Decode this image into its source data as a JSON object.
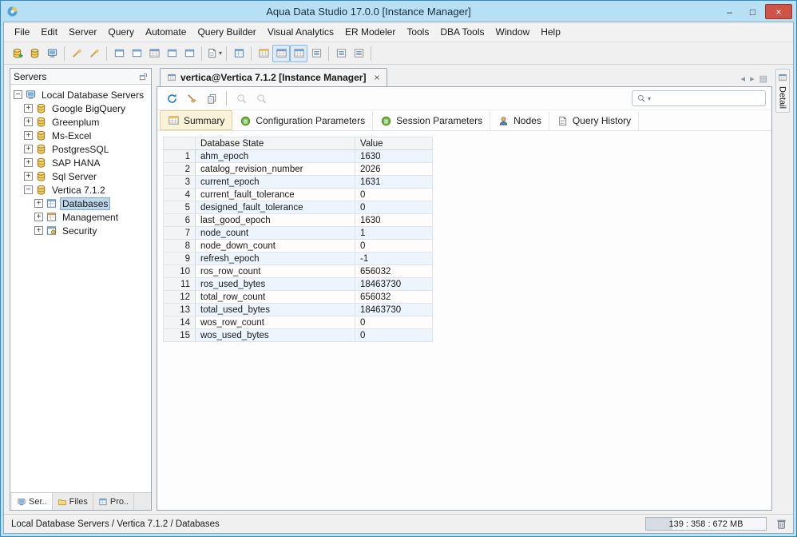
{
  "window": {
    "title": "Aqua Data Studio 17.0.0 [Instance Manager]",
    "controls": {
      "minimize": "–",
      "maximize": "□",
      "close": "×"
    }
  },
  "menu": {
    "items": [
      "File",
      "Edit",
      "Server",
      "Query",
      "Automate",
      "Query Builder",
      "Visual Analytics",
      "ER Modeler",
      "Tools",
      "DBA Tools",
      "Window",
      "Help"
    ]
  },
  "toolbar": {
    "icons": [
      {
        "name": "register-server",
        "sym": "dbplus"
      },
      {
        "name": "connect-server",
        "sym": "db"
      },
      {
        "name": "server-properties",
        "sym": "server"
      },
      {
        "sep": true
      },
      {
        "name": "schema-wizard",
        "sym": "wand"
      },
      {
        "name": "import-wizard",
        "sym": "wand"
      },
      {
        "sep": true
      },
      {
        "name": "window-query-analyzer",
        "sym": "win"
      },
      {
        "name": "window-admin",
        "sym": "win"
      },
      {
        "name": "window-instance-manager",
        "sym": "grid-b"
      },
      {
        "name": "window-storage",
        "sym": "win"
      },
      {
        "name": "window-security",
        "sym": "win"
      },
      {
        "sep": true
      },
      {
        "name": "new-document",
        "sym": "doc",
        "caret": true
      },
      {
        "sep": true
      },
      {
        "name": "server-browser",
        "sym": "objects"
      },
      {
        "sep": true
      },
      {
        "name": "view-summary",
        "sym": "grid-y"
      },
      {
        "name": "view-grid",
        "sym": "grid-b",
        "active": true
      },
      {
        "name": "view-pivot",
        "sym": "grid-b",
        "active": true
      },
      {
        "name": "view-form",
        "sym": "list"
      },
      {
        "sep": true
      },
      {
        "name": "view-text",
        "sym": "list"
      },
      {
        "name": "view-chart",
        "sym": "list"
      },
      {
        "sep": true
      }
    ]
  },
  "servers_panel": {
    "title": "Servers",
    "tree": [
      {
        "label": "Local Database Servers",
        "depth": 0,
        "expander": "-",
        "icon": "server"
      },
      {
        "label": "Google BigQuery",
        "depth": 1,
        "expander": "+",
        "icon": "db"
      },
      {
        "label": "Greenplum",
        "depth": 1,
        "expander": "+",
        "icon": "db"
      },
      {
        "label": "Ms-Excel",
        "depth": 1,
        "expander": "+",
        "icon": "db"
      },
      {
        "label": "PostgresSQL",
        "depth": 1,
        "expander": "+",
        "icon": "db"
      },
      {
        "label": "SAP HANA",
        "depth": 1,
        "expander": "+",
        "icon": "db"
      },
      {
        "label": "Sql Server",
        "depth": 1,
        "expander": "+",
        "icon": "db"
      },
      {
        "label": "Vertica 7.1.2",
        "depth": 1,
        "expander": "-",
        "icon": "db"
      },
      {
        "label": "Databases",
        "depth": 2,
        "expander": "+",
        "icon": "objects",
        "selected": true
      },
      {
        "label": "Management",
        "depth": 2,
        "expander": "+",
        "icon": "mgmt"
      },
      {
        "label": "Security",
        "depth": 2,
        "expander": "+",
        "icon": "security"
      }
    ],
    "bottom_tabs": [
      {
        "label": "Ser..",
        "icon": "server",
        "active": true
      },
      {
        "label": "Files",
        "icon": "folder"
      },
      {
        "label": "Pro..",
        "icon": "objects"
      }
    ]
  },
  "document": {
    "tab_label": "vertica@Vertica 7.1.2 [Instance Manager]",
    "close_glyph": "×",
    "toolbar_icons": [
      {
        "name": "refresh",
        "sym": "refresh"
      },
      {
        "name": "auto-format",
        "sym": "broom"
      },
      {
        "name": "copy",
        "sym": "copy"
      },
      {
        "sep": true
      },
      {
        "name": "zoom-out",
        "sym": "zoom",
        "disabled": true
      },
      {
        "name": "zoom-in",
        "sym": "zoom",
        "disabled": true
      }
    ]
  },
  "search": {
    "value": ""
  },
  "subtabs": [
    {
      "label": "Summary",
      "icon": "grid-y",
      "active": true
    },
    {
      "label": "Configuration Parameters",
      "icon": "param"
    },
    {
      "label": "Session Parameters",
      "icon": "param"
    },
    {
      "label": "Nodes",
      "icon": "node"
    },
    {
      "label": "Query History",
      "icon": "doc"
    }
  ],
  "grid": {
    "columns": [
      "Database State",
      "Value"
    ],
    "rows": [
      {
        "n": "1",
        "name": "ahm_epoch",
        "value": "1630"
      },
      {
        "n": "2",
        "name": "catalog_revision_number",
        "value": "2026"
      },
      {
        "n": "3",
        "name": "current_epoch",
        "value": "1631"
      },
      {
        "n": "4",
        "name": "current_fault_tolerance",
        "value": "0"
      },
      {
        "n": "5",
        "name": "designed_fault_tolerance",
        "value": "0"
      },
      {
        "n": "6",
        "name": "last_good_epoch",
        "value": "1630"
      },
      {
        "n": "7",
        "name": "node_count",
        "value": "1"
      },
      {
        "n": "8",
        "name": "node_down_count",
        "value": "0"
      },
      {
        "n": "9",
        "name": "refresh_epoch",
        "value": "-1"
      },
      {
        "n": "10",
        "name": "ros_row_count",
        "value": "656032"
      },
      {
        "n": "11",
        "name": "ros_used_bytes",
        "value": "18463730"
      },
      {
        "n": "12",
        "name": "total_row_count",
        "value": "656032"
      },
      {
        "n": "13",
        "name": "total_used_bytes",
        "value": "18463730"
      },
      {
        "n": "14",
        "name": "wos_row_count",
        "value": "0"
      },
      {
        "n": "15",
        "name": "wos_used_bytes",
        "value": "0"
      }
    ]
  },
  "detail_panel": {
    "label": "Detail"
  },
  "status_bar": {
    "path": "Local Database Servers / Vertica 7.1.2 / Databases",
    "memory": "139 : 358 : 672 MB"
  }
}
